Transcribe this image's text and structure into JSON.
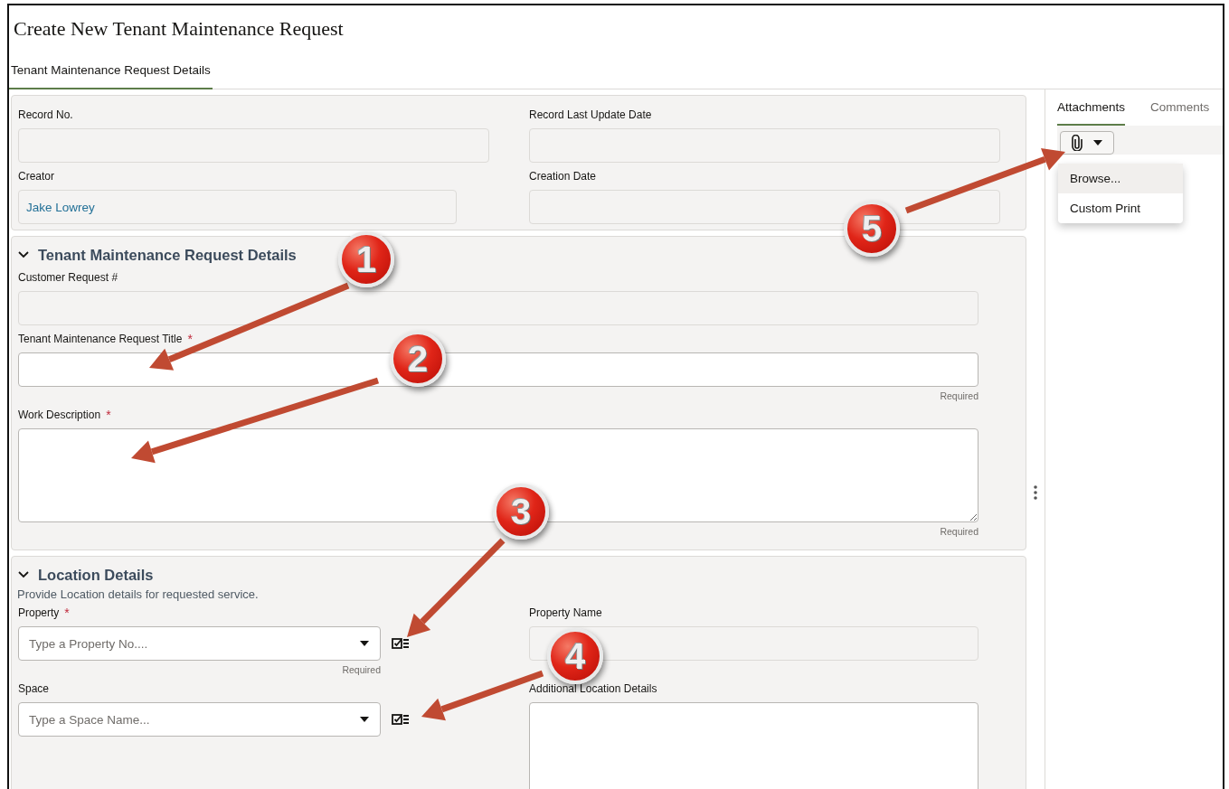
{
  "page": {
    "title": "Create New Tenant Maintenance Request"
  },
  "tabs": [
    {
      "label": "Tenant Maintenance Request Details",
      "selected": true
    }
  ],
  "record_card": {
    "columns": [
      [
        {
          "kind": "readonly",
          "label": "Record No."
        },
        {
          "kind": "readonly",
          "label": "Creator",
          "value": "Jake Lowrey"
        }
      ],
      [
        {
          "kind": "readonly",
          "label": "Record Last Update Date"
        },
        {
          "kind": "readonly",
          "label": "Creation Date"
        }
      ]
    ]
  },
  "sections": [
    {
      "title": "Tenant Maintenance Request Details",
      "expanded": true,
      "columns": [
        [
          {
            "kind": "readonly",
            "label": "Customer Request #"
          },
          {
            "kind": "text",
            "label": "Tenant Maintenance Request Title",
            "required_mark": "*",
            "hint": "Required"
          },
          {
            "kind": "textarea",
            "label": "Work Description",
            "required_mark": "*",
            "hint": "Required"
          }
        ]
      ]
    },
    {
      "title": "Location Details",
      "expanded": true,
      "description": "Provide Location details for requested service.",
      "columns": [
        [
          {
            "kind": "combo",
            "label": "Property",
            "required_mark": "*",
            "placeholder": "Type a Property No....",
            "hint": "Required"
          },
          {
            "kind": "combo",
            "label": "Space",
            "placeholder": "Type a Space Name..."
          }
        ],
        [
          {
            "kind": "readonly",
            "label": "Property Name"
          },
          {
            "kind": "textarea",
            "label": "Additional Location Details"
          }
        ]
      ]
    }
  ],
  "side_panel": {
    "tabs": [
      {
        "label": "Attachments",
        "selected": true
      },
      {
        "label": "Comments",
        "selected": false
      }
    ],
    "menu": [
      {
        "label": "Browse...",
        "highlighted": true
      },
      {
        "label": "Custom Print",
        "highlighted": false
      }
    ]
  },
  "annotations": [
    {
      "number": "1"
    },
    {
      "number": "2"
    },
    {
      "number": "3"
    },
    {
      "number": "4"
    },
    {
      "number": "5"
    }
  ]
}
